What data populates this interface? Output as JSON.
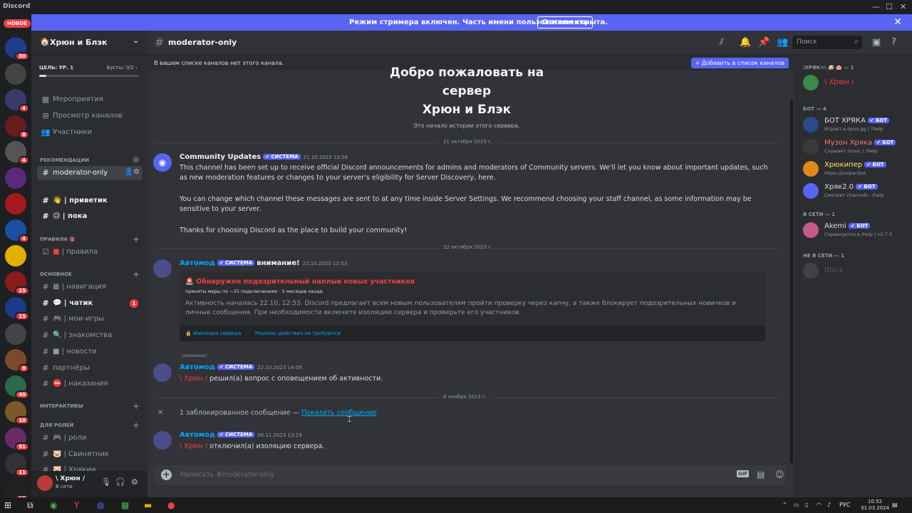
{
  "window": {
    "title": "Discord",
    "controls": [
      "—",
      "☐",
      "✕"
    ]
  },
  "banner": {
    "text": "Режим стримера включен. Часть имени пользователя скрыта.",
    "button": "Отключить",
    "close": "✕"
  },
  "server_rail": {
    "new_label": "НОВОЕ",
    "servers": [
      {
        "name": "DDrop",
        "badge": "30",
        "color": "#1f3c88"
      },
      {
        "name": "P",
        "badge": "",
        "color": "#444"
      },
      {
        "name": "S",
        "badge": "4",
        "color": "#3a3a6a"
      },
      {
        "name": "NEVERLAND",
        "badge": "8",
        "color": "#6a1b1b"
      },
      {
        "name": "Gun",
        "badge": "4",
        "color": "#555"
      },
      {
        "name": "hz",
        "badge": "",
        "color": "#5a2a7a"
      },
      {
        "name": "MINTE",
        "badge": "",
        "color": "#a21b1b"
      },
      {
        "name": "PC",
        "badge": "4",
        "color": "#1b4fa2"
      },
      {
        "name": "Rad",
        "badge": "",
        "color": "#e0b000"
      },
      {
        "name": "Red",
        "badge": "15",
        "color": "#8a1b1b"
      },
      {
        "name": "Blue",
        "badge": "15",
        "color": "#1b3a8a"
      },
      {
        "name": "Swirl",
        "badge": "",
        "color": "#444"
      },
      {
        "name": "Face",
        "badge": "9",
        "color": "#7a4a2a"
      },
      {
        "name": "VOICE",
        "badge": "40",
        "color": "#2a6a4a"
      },
      {
        "name": "Guy",
        "badge": "10",
        "color": "#7a5a2a"
      },
      {
        "name": "Mix",
        "badge": "91",
        "color": "#6a2a6a"
      },
      {
        "name": "Skull",
        "badge": "11",
        "color": "#333"
      },
      {
        "name": "Run",
        "badge": "25",
        "color": "#222"
      }
    ]
  },
  "guild": {
    "name": "Хрюн и Блэк",
    "boost_goal": "ЦЕЛЬ: УР. 1",
    "boosts": "Бусты: 0/2",
    "boost_progress": 0.07,
    "top_links": [
      "Мероприятия",
      "Просмотр каналов",
      "Участники"
    ],
    "recommended_label": "РЕКОМЕНДАЦИИ",
    "active_channel": "moderator-only",
    "channels_top": [
      {
        "icon": "👋",
        "name": "| приветик"
      },
      {
        "icon": "😥",
        "name": "| пока"
      }
    ],
    "cat_rules": "ПРАВИЛА 🔞",
    "rules_channel": "| правила",
    "cat_main": "ОСНОВНОЕ",
    "main_channels": [
      {
        "name": "| навигация",
        "bold": false,
        "unread": ""
      },
      {
        "name": "| чатик",
        "bold": true,
        "unread": "1"
      },
      {
        "name": "| мои-игры",
        "bold": false,
        "unread": ""
      },
      {
        "name": "| знакомства",
        "bold": false,
        "unread": ""
      },
      {
        "name": "| новости",
        "bold": false,
        "unread": ""
      },
      {
        "name": "партнёры",
        "bold": false,
        "unread": ""
      },
      {
        "name": "| наказания",
        "bold": false,
        "unread": ""
      }
    ],
    "cat_interactive": "ИНТЕРАКТИВЫ",
    "cat_roles": "ДЛЯ РОЛЕЙ",
    "role_channels": [
      "| роли",
      "| Свинятник",
      "| Хрякии"
    ]
  },
  "user": {
    "name": "\\ Хрюн /",
    "status": "В сети"
  },
  "channel": {
    "name": "moderator-only",
    "search_placeholder": "Поиск",
    "notice": "В вашем списке каналов нет этого канала.",
    "add_button": "+ Добавить в список каналов",
    "welcome_lines": [
      "Добро пожаловать на",
      "сервер",
      "Хрюн и Блэк"
    ],
    "welcome_sub": "Это начало истории этого сервера.",
    "date1": "21 октября 2023 г.",
    "date2": "22 октября 2023 г.",
    "date3": "6 ноября 2023 г.",
    "composer_placeholder": "Написать #moderator-only",
    "gif_label": "GIF"
  },
  "messages": {
    "m1": {
      "author": "Community Updates",
      "tag": "✔ СИСТЕМА",
      "time": "21.10.2023 13:58",
      "p1": "This channel has been set up to receive official Discord announcements for admins and moderators of Community servers. We'll let you know about important updates, such as new moderation features or changes to your server's eligibility for Server Discovery, here.",
      "p2": "You can change which channel these messages are sent to at any time inside Server Settings. We recommend choosing your staff channel, as some information may be sensitive to your server.",
      "p3": "Thanks for choosing Discord as the place to build your community!"
    },
    "m2": {
      "author": "Автомод",
      "tag": "✔ СИСТЕМА",
      "suffix": "внимание!",
      "time": "22.10.2023 12:53",
      "embed_title": "🚨 Обнаружен подозрительный наплыв новых участников",
      "embed_meta": "приняты меры по ~25 подключениям · 5 месяцев назад",
      "embed_desc": "Активность началась 22.10, 12:53. Discord предлагает всем новым пользователям пройти проверку через капчу, а также блокирует подозрительных новичков и личные сообщения. При необходимости включите изоляцию сервера и проверьте его участников.",
      "embed_link1": "🔒 Изоляция сервера",
      "embed_link2": "Решено: действия не требуются",
      "edited": "(изменено)"
    },
    "m3": {
      "author": "Автомод",
      "tag": "✔ СИСТЕМА",
      "time": "22.10.2023 14:09",
      "who": "\\ Хрюн /",
      "text": "решил(а) вопрос с оповещением об активности."
    },
    "blocked": {
      "text": "1 заблокированное сообщение —",
      "link": "Показать сообщение"
    },
    "m4": {
      "author": "Автомод",
      "tag": "✔ СИСТЕМА",
      "time": "06.11.2023 13:19",
      "who": "\\ Хрюн /",
      "text": "отключил(а) изоляцию сервера."
    }
  },
  "members": {
    "cat1": "\\ХРЯК<\\ 🍻 🐽 — 1",
    "owner": {
      "name": "\\ Хрюн /",
      "color": "#f23f43"
    },
    "cat_bots": "БОТ — 4",
    "bots": [
      {
        "name": "БОТ ХРЯКА",
        "status": "Играет в dyno.gg | ?help",
        "color": "#dbdee1",
        "av": "#2a4a8a"
      },
      {
        "name": "Музон Хряка",
        "status": "Слушает music | !help",
        "color": "#f47b67",
        "av": "#3a3a3a"
      },
      {
        "name": "Хрюкипер",
        "status": "https://juniper.bot",
        "color": "#fee75c",
        "av": "#e08a1b"
      },
      {
        "name": "Хряк2.0",
        "status": "Смотрит channels - /help",
        "color": "#dbdee1",
        "av": "#5865f2"
      }
    ],
    "bot_tag": "✔ БОТ",
    "cat_online": "В СЕТИ — 1",
    "online": [
      {
        "name": "Akemi",
        "status": "Соревнуется в /help | v2.7.3",
        "color": "#dbdee1",
        "av": "#c85a8a"
      }
    ],
    "cat_offline": "НЕ В СЕТИ — 1",
    "offline": [
      {
        "name": "Black",
        "color": "#4e5058"
      }
    ]
  },
  "taskbar": {
    "lang": "РУС",
    "time": "10:52",
    "date": "31.03.2024"
  }
}
